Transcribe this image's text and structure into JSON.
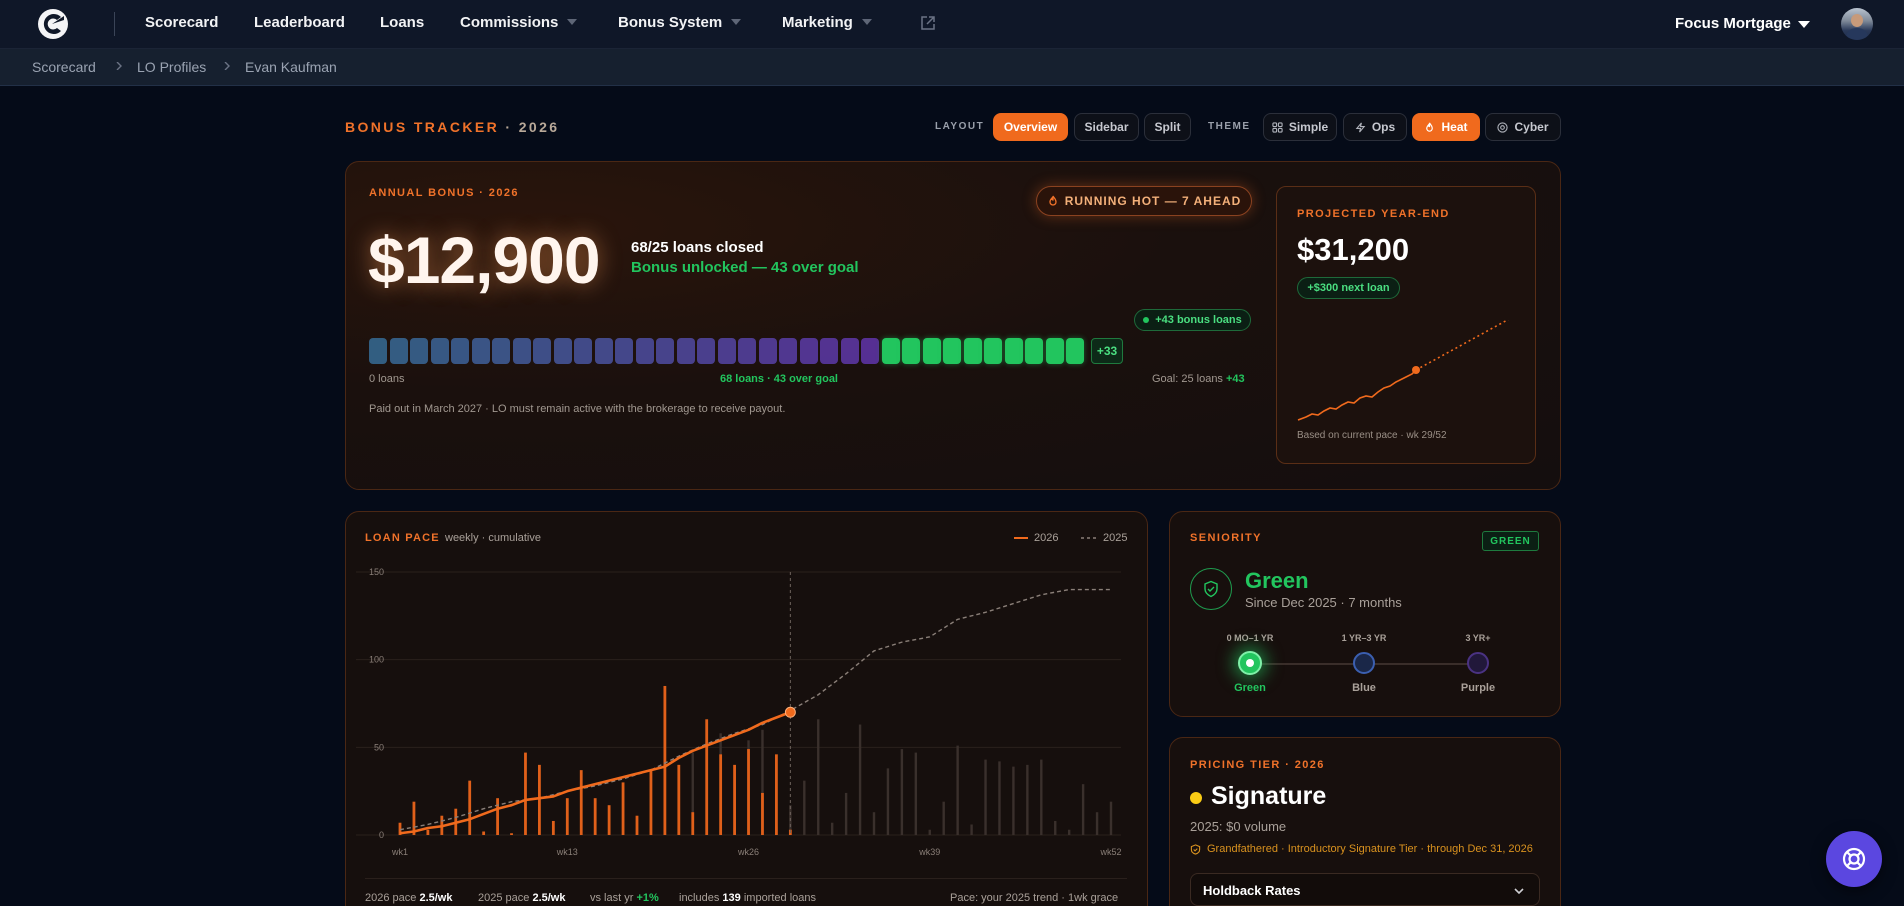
{
  "nav": {
    "items": [
      {
        "label": "Scorecard"
      },
      {
        "label": "Leaderboard"
      },
      {
        "label": "Loans"
      },
      {
        "label": "Commissions"
      },
      {
        "label": "Bonus System"
      },
      {
        "label": "Marketing"
      }
    ],
    "org_name": "Focus Mortgage",
    "icons": {
      "logo": "brand-c-logo",
      "external": "external-link-icon",
      "avatar": "user-avatar"
    }
  },
  "breadcrumb": [
    "Scorecard",
    "LO Profiles",
    "Evan Kaufman"
  ],
  "tracker": {
    "title": "BONUS TRACKER",
    "year": "· 2026",
    "layout_label": "LAYOUT",
    "layout_options": [
      "Overview",
      "Sidebar",
      "Split"
    ],
    "layout_active": "Overview",
    "theme_label": "THEME",
    "theme_options": [
      "Simple",
      "Ops",
      "Heat",
      "Cyber"
    ],
    "theme_active": "Heat"
  },
  "annual": {
    "eyebrow": "ANNUAL BONUS · 2026",
    "status_badge": "RUNNING HOT — 7 AHEAD",
    "amount": "$12,900",
    "closed_text": "68/25 loans closed",
    "unlocked_text": "Bonus unlocked — 43 over goal",
    "bonus_chip": "+43 bonus loans",
    "overflow_chip": "+33",
    "start_label": "0 loans",
    "center_label": "68 loans · 43 over goal",
    "goal_label": "Goal: 25 loans",
    "goal_extra": "+43",
    "payout_note": "Paid out in March 2027 · LO must remain active with the brokerage to receive payout.",
    "progress": {
      "goal_cells": 25,
      "bonus_cells": 10
    },
    "colors": {
      "accent": "#f06a1d",
      "goal_start": "#3a78a8",
      "goal_end": "#6a3ac0",
      "bonus": "#22c55e"
    }
  },
  "projected": {
    "eyebrow": "PROJECTED YEAR-END",
    "amount": "$31,200",
    "chip": "+$300 next loan",
    "footnote": "Based on current pace · wk 29/52"
  },
  "pace": {
    "title": "LOAN PACE",
    "subtitle": "weekly · cumulative",
    "legend": [
      {
        "label": "2026",
        "color": "#f06a1d"
      },
      {
        "label": "2025",
        "color": "#8a7f78"
      }
    ],
    "footer": {
      "pace_2026_label": "2026 pace",
      "pace_2026_value": "2.5/wk",
      "pace_2025_label": "2025 pace",
      "pace_2025_value": "2.5/wk",
      "vs_label": "vs last yr",
      "vs_value": "+1%",
      "imported_prefix": "includes",
      "imported_value": "139",
      "imported_suffix": "imported loans",
      "right_note": "Pace: your 2025 trend · 1wk grace"
    }
  },
  "chart_data": {
    "type": "line",
    "title": "LOAN PACE",
    "subtitle": "weekly · cumulative",
    "xlabel": "",
    "ylabel": "",
    "x_ticks": [
      "wk1",
      "wk13",
      "wk26",
      "wk39",
      "wk52"
    ],
    "y_ticks": [
      0,
      50,
      100,
      150
    ],
    "ylim": [
      0,
      150
    ],
    "xlim": [
      1,
      52
    ],
    "current_week": 29,
    "series": [
      {
        "name": "2026",
        "style": "solid",
        "color": "#f06a1d",
        "x": [
          1,
          2,
          3,
          4,
          5,
          6,
          7,
          8,
          9,
          10,
          11,
          12,
          13,
          14,
          15,
          16,
          17,
          18,
          19,
          20,
          21,
          22,
          23,
          24,
          25,
          26,
          27,
          28,
          29
        ],
        "values": [
          1,
          2,
          4,
          5,
          7,
          9,
          12,
          15,
          17,
          20,
          21,
          22,
          25,
          27,
          29,
          31,
          33,
          35,
          37,
          39,
          44,
          48,
          51,
          54,
          57,
          60,
          64,
          67,
          70
        ]
      },
      {
        "name": "2025",
        "style": "dashed",
        "color": "#8a7f78",
        "x": [
          1,
          3,
          5,
          7,
          9,
          11,
          13,
          15,
          17,
          19,
          21,
          23,
          25,
          27,
          29,
          31,
          33,
          35,
          37,
          39,
          41,
          43,
          45,
          47,
          49,
          51,
          52
        ],
        "values": [
          3,
          6,
          10,
          15,
          19,
          21,
          25,
          28,
          32,
          37,
          45,
          52,
          58,
          63,
          71,
          80,
          92,
          105,
          110,
          113,
          123,
          127,
          132,
          137,
          140,
          140,
          140
        ]
      }
    ],
    "weekly_bars_2026": [
      7,
      19,
      3,
      11,
      15,
      31,
      2,
      21,
      1,
      47,
      40,
      8,
      21,
      37,
      21,
      17,
      30,
      11,
      37,
      85,
      40,
      13,
      66,
      46,
      40,
      49,
      24,
      46,
      3
    ],
    "weekly_bars_2025": [
      47,
      44,
      58,
      4,
      54,
      60,
      5,
      17,
      31,
      66,
      7,
      24,
      63,
      13,
      38,
      49,
      47,
      3,
      19,
      51,
      6,
      43,
      42,
      39,
      40,
      43,
      8,
      3,
      29,
      13,
      19
    ]
  },
  "seniority": {
    "eyebrow": "SENIORITY",
    "badge": "GREEN",
    "level": "Green",
    "since": "Since Dec 2025 · 7 months",
    "tiers": [
      {
        "range": "0 MO–1 YR",
        "name": "Green",
        "color": "#22c55e"
      },
      {
        "range": "1 YR–3 YR",
        "name": "Blue",
        "color": "#3b5fb0"
      },
      {
        "range": "3 YR+",
        "name": "Purple",
        "color": "#5b3a9a"
      }
    ]
  },
  "pricing": {
    "eyebrow": "PRICING TIER · 2026",
    "tier": "Signature",
    "volume": "2025: $0 volume",
    "grandfather": "Grandfathered · Introductory Signature Tier · through Dec 31, 2026",
    "holdback": "Holdback Rates"
  }
}
